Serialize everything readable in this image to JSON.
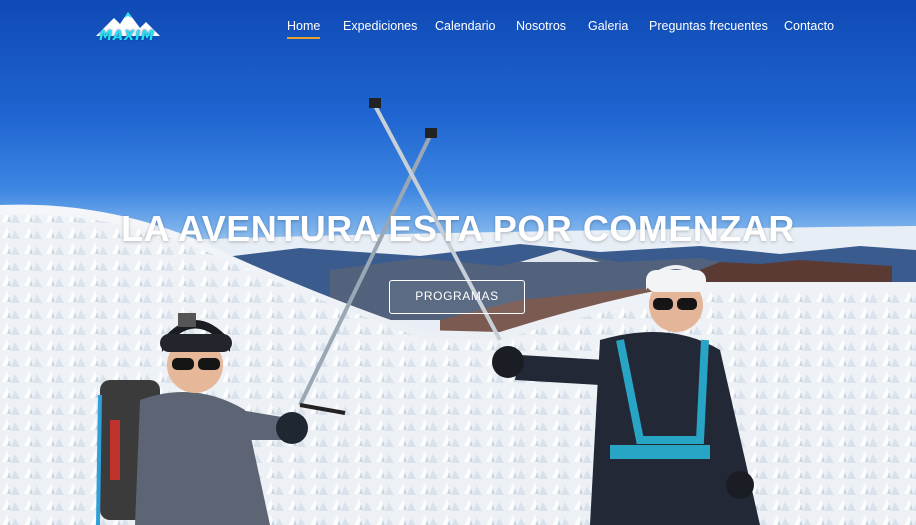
{
  "brand": {
    "logo_text": "MAXIM",
    "logo_color": "#22e0f2"
  },
  "nav": {
    "items": [
      {
        "label": "Home",
        "active": true
      },
      {
        "label": "Expediciones",
        "active": false
      },
      {
        "label": "Calendario",
        "active": false
      },
      {
        "label": "Nosotros",
        "active": false
      },
      {
        "label": "Galeria",
        "active": false
      },
      {
        "label": "Preguntas frecuentes",
        "active": false
      },
      {
        "label": "Contacto",
        "active": false
      }
    ],
    "active_underline_color": "#e8a32a"
  },
  "hero": {
    "headline": "LA AVENTURA ESTA POR COMENZAR",
    "cta_label": "PROGRAMAS",
    "image_subject": "two climbers with crossed trekking poles on a snowy volcano slope"
  }
}
